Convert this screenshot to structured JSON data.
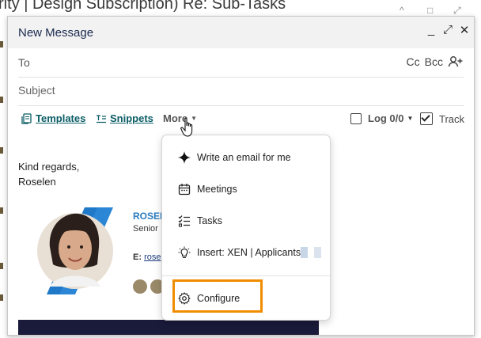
{
  "background": {
    "title_fragment": "rity | Design Subscription) Re: Sub-Tasks"
  },
  "compose": {
    "title": "New Message",
    "window_controls": {
      "minimize": "_",
      "expand": "⤢",
      "close": "✕"
    },
    "to_label": "To",
    "cc_label": "Cc",
    "bcc_label": "Bcc",
    "subject_placeholder": "Subject"
  },
  "toolbar": {
    "templates_label": "Templates",
    "snippets_label": "Snippets",
    "more_label": "More",
    "log_label": "Log 0/0",
    "log_checked": false,
    "track_label": "Track",
    "track_checked": true
  },
  "body": {
    "line1": "Kind regards,",
    "line2": "Roselen"
  },
  "signature": {
    "name_fragment": "ROSEL",
    "role_fragment": "Senior",
    "email_label": "E:",
    "email_fragment": "rose"
  },
  "more_menu": {
    "items": [
      {
        "icon": "sparkle-icon",
        "label": "Write an email for me"
      },
      {
        "icon": "calendar-icon",
        "label": "Meetings"
      },
      {
        "icon": "checklist-icon",
        "label": "Tasks"
      },
      {
        "icon": "lightbulb-icon",
        "label": "Insert: XEN | Applicants"
      },
      {
        "icon": "gear-icon",
        "label": "Configure"
      }
    ]
  },
  "colors": {
    "link": "#0b5d66",
    "highlight": "#f08c00",
    "title": "#1b2a4e"
  }
}
